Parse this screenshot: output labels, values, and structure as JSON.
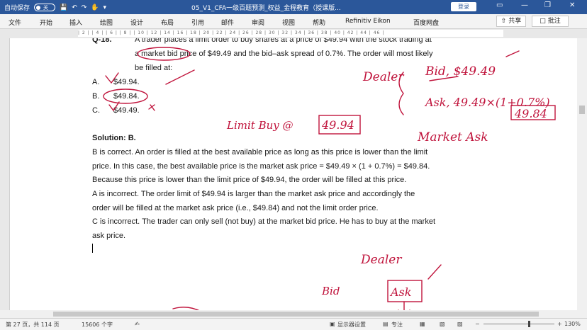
{
  "titlebar": {
    "autosave_label": "自动保存",
    "toggle_state": "关",
    "doc_title": "05_V1_CFA一级百题预测_权益_金程教育（授课版...",
    "login_label": "登录"
  },
  "ribbon": {
    "tabs": [
      "文件",
      "开始",
      "插入",
      "绘图",
      "设计",
      "布局",
      "引用",
      "邮件",
      "审阅",
      "视图",
      "帮助",
      "Refinitiv Eikon",
      "百度网盘"
    ],
    "share_label": "共享",
    "comment_label": "批注"
  },
  "ruler": {
    "marks": "| 2 | | 4 | | 6 | | 8 | | 10 | 12 | 14 | 16 | 18 | 20 | 22 | 24 | 26 | 28 | 30 | 32 | 34 | 36 | 38 | 40 | 42 | 44 | 46 |"
  },
  "document": {
    "q_prefix": "Q-18.",
    "q_line1": "A trader places a limit order to buy shares at a price of $49.94 with the stock trading at",
    "q_line2": "a market bid price of $49.49 and the bid–ask spread of 0.7%. The order will most likely",
    "q_line3": "be filled at:",
    "options": [
      {
        "letter": "A.",
        "text": "$49.94."
      },
      {
        "letter": "B.",
        "text": "$49.84."
      },
      {
        "letter": "C.",
        "text": "$49.49."
      }
    ],
    "solution_title": "Solution: B.",
    "solution_lines": [
      "B is correct. An order is filled at the best available price as long as this price is lower than the limit",
      "price. In this case, the best available price is the market ask price = $49.49 × (1 + 0.7%) = $49.84.",
      "Because this price is lower than the limit price of $49.94, the order will be filled at this price.",
      "A is incorrect. The order limit of $49.94 is larger than the market ask price and accordingly the",
      "order will be filled at the market ask price (i.e., $49.84) and not the limit order price.",
      "C is incorrect. The trader can only sell (not buy) at the market bid price. He has to buy at the market",
      "ask price."
    ]
  },
  "annotations": {
    "dealer_top": "Dealer",
    "bid_note": "Bid, $49.49",
    "ask_note": "Ask, 49.49×(1+0.7%)",
    "ask_result": "49.84",
    "limit_buy": "Limit Buy @",
    "limit_price": "49.94",
    "market_ask": "Market Ask",
    "dealer_bottom": "Dealer",
    "bid_bottom": "Bid",
    "ask_bottom": "Ask"
  },
  "statusbar": {
    "page_info": "第 27 页，共 114 页",
    "word_count": "15606 个字",
    "display_settings": "显示器设置",
    "focus": "专注",
    "zoom": "130%"
  },
  "colors": {
    "title_bar": "#2b579a",
    "ink": "#c0143c"
  }
}
